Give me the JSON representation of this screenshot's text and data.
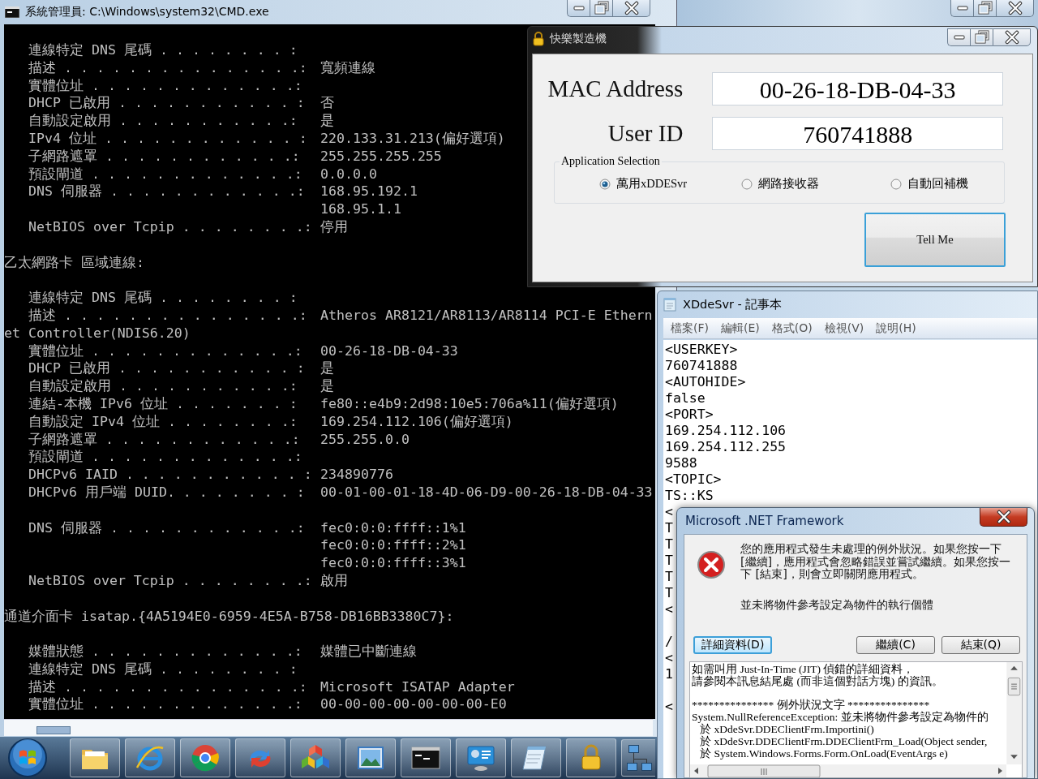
{
  "cmd_window": {
    "title": "系統管理員: C:\\Windows\\system32\\CMD.exe",
    "lines": [
      {
        "kind": "entry",
        "label": "連線特定 DNS 尾碼 . . . . . . . . :"
      },
      {
        "kind": "entry",
        "label": "描述 . . . . . . . . . . . . . . .:",
        "value": "寬頻連線"
      },
      {
        "kind": "entry",
        "label": "實體位址 . . . . . . . . . . . . .:"
      },
      {
        "kind": "entry",
        "label": "DHCP 已啟用 . . . . . . . . . . . :",
        "value": "否"
      },
      {
        "kind": "entry",
        "label": "自動設定啟用 . . . . . . . . . . .:",
        "value": "是"
      },
      {
        "kind": "entry",
        "label": "IPv4 位址 . . . . . . . . . . . . :",
        "value": "220.133.31.213(偏好選項)"
      },
      {
        "kind": "entry",
        "label": "子網路遮罩 . . . . . . . . . . . .:",
        "value": "255.255.255.255"
      },
      {
        "kind": "entry",
        "label": "預設閘道 . . . . . . . . . . . . .:",
        "value": "0.0.0.0"
      },
      {
        "kind": "entry",
        "label": "DNS 伺服器 . . . . . . . . . . . .:",
        "value": "168.95.192.1"
      },
      {
        "kind": "continuation",
        "value": "168.95.1.1"
      },
      {
        "kind": "entry",
        "label": "NetBIOS over Tcpip . . . . . . . .:",
        "value": "停用"
      },
      {
        "kind": "blank"
      },
      {
        "kind": "heading",
        "text": "乙太網路卡 區域連線:"
      },
      {
        "kind": "blank"
      },
      {
        "kind": "entry",
        "label": "連線特定 DNS 尾碼 . . . . . . . . :"
      },
      {
        "kind": "entry",
        "label": "描述 . . . . . . . . . . . . . . .:",
        "value": "Atheros AR8121/AR8113/AR8114 PCI-E Ethern"
      },
      {
        "kind": "heading",
        "text": "et Controller(NDIS6.20)"
      },
      {
        "kind": "entry",
        "label": "實體位址 . . . . . . . . . . . . .:",
        "value": "00-26-18-DB-04-33"
      },
      {
        "kind": "entry",
        "label": "DHCP 已啟用 . . . . . . . . . . . :",
        "value": "是"
      },
      {
        "kind": "entry",
        "label": "自動設定啟用 . . . . . . . . . . .:",
        "value": "是"
      },
      {
        "kind": "entry",
        "label": "連結-本機 IPv6 位址 . . . . . . . :",
        "value": "fe80::e4b9:2d98:10e5:706a%11(偏好選項)"
      },
      {
        "kind": "entry",
        "label": "自動設定 IPv4 位址 . . . . . . . .:",
        "value": "169.254.112.106(偏好選項)"
      },
      {
        "kind": "entry",
        "label": "子網路遮罩 . . . . . . . . . . . .:",
        "value": "255.255.0.0"
      },
      {
        "kind": "entry",
        "label": "預設閘道 . . . . . . . . . . . . .:"
      },
      {
        "kind": "entry",
        "label": "DHCPv6 IAID . . . . . . . . . . . :",
        "value": "234890776"
      },
      {
        "kind": "entry",
        "label": "DHCPv6 用戶端 DUID. . . . . . . . :",
        "value": "00-01-00-01-18-4D-06-D9-00-26-18-DB-04-33"
      },
      {
        "kind": "blank"
      },
      {
        "kind": "entry",
        "label": "DNS 伺服器 . . . . . . . . . . . .:",
        "value": "fec0:0:0:ffff::1%1"
      },
      {
        "kind": "continuation",
        "value": "fec0:0:0:ffff::2%1"
      },
      {
        "kind": "continuation",
        "value": "fec0:0:0:ffff::3%1"
      },
      {
        "kind": "entry",
        "label": "NetBIOS over Tcpip . . . . . . . .:",
        "value": "啟用"
      },
      {
        "kind": "blank"
      },
      {
        "kind": "heading",
        "text": "通道介面卡 isatap.{4A5194E0-6959-4E5A-B758-DB16BB3380C7}:"
      },
      {
        "kind": "blank"
      },
      {
        "kind": "entry",
        "label": "媒體狀態 . . . . . . . . . . . . .:",
        "value": "媒體已中斷連線"
      },
      {
        "kind": "entry",
        "label": "連線特定 DNS 尾碼 . . . . . . . . :"
      },
      {
        "kind": "entry",
        "label": "描述 . . . . . . . . . . . . . . .:",
        "value": "Microsoft ISATAP Adapter"
      },
      {
        "kind": "entry",
        "label": "實體位址 . . . . . . . . . . . . .:",
        "value": "00-00-00-00-00-00-00-E0"
      }
    ]
  },
  "app_window": {
    "title": "快樂製造機",
    "fields": [
      {
        "label": "MAC Address",
        "value": "00-26-18-DB-04-33"
      },
      {
        "label": "User ID",
        "value": "760741888"
      }
    ],
    "group_title": "Application Selection",
    "options": [
      {
        "label": "萬用xDDESvr",
        "selected": true
      },
      {
        "label": "網路接收器",
        "selected": false
      },
      {
        "label": "自動回補機",
        "selected": false
      }
    ],
    "button": "Tell Me"
  },
  "notepad": {
    "title": "XDdeSvr - 記事本",
    "menu": [
      "檔案(F)",
      "編輯(E)",
      "格式(O)",
      "檢視(V)",
      "說明(H)"
    ],
    "lines": [
      {
        "kind": "text",
        "text": "<USERKEY>"
      },
      {
        "kind": "text",
        "text": "760741888"
      },
      {
        "kind": "text",
        "text": "<AUTOHIDE>"
      },
      {
        "kind": "text",
        "text": "false"
      },
      {
        "kind": "text",
        "text": "<PORT>"
      },
      {
        "kind": "text",
        "text": "169.254.112.106"
      },
      {
        "kind": "text",
        "text": "169.254.112.255"
      },
      {
        "kind": "text",
        "text": "9588"
      },
      {
        "kind": "text",
        "text": "<TOPIC>"
      },
      {
        "kind": "text",
        "text": "TS::KS"
      },
      {
        "kind": "text",
        "text": "<"
      },
      {
        "kind": "text",
        "text": "T"
      },
      {
        "kind": "text",
        "text": "T"
      },
      {
        "kind": "text",
        "text": "T"
      },
      {
        "kind": "text",
        "text": "T"
      },
      {
        "kind": "text",
        "text": "T"
      },
      {
        "kind": "text",
        "text": "<"
      },
      {
        "kind": "blank"
      },
      {
        "kind": "text",
        "text": "/"
      },
      {
        "kind": "text",
        "text": "<"
      },
      {
        "kind": "text",
        "text": "1"
      },
      {
        "kind": "blank"
      },
      {
        "kind": "text",
        "text": "<"
      }
    ]
  },
  "dialog": {
    "title": "Microsoft .NET Framework",
    "message": "您的應用程式發生未處理的例外狀況。如果您按一下 [繼續]，應用程式會忽略錯誤並嘗試繼續。如果您按一下 [結束]，則會立即關閉應用程式。",
    "error": "並未將物件參考設定為物件的執行個體",
    "buttons": [
      {
        "label": "詳細資料(D)",
        "focused": true
      },
      {
        "label": "繼續(C)",
        "focused": false
      },
      {
        "label": "結束(Q)",
        "focused": false
      }
    ],
    "details": [
      {
        "kind": "text",
        "text": "如需叫用 Just-In-Time (JIT) 偵錯的詳細資料，"
      },
      {
        "kind": "text",
        "text": "請參閱本訊息結尾處 (而非這個對話方塊) 的資訊。"
      },
      {
        "kind": "blank"
      },
      {
        "kind": "text",
        "text": "*************** 例外狀況文字 ***************"
      },
      {
        "kind": "text",
        "text": "System.NullReferenceException: 並未將物件參考設定為物件的"
      },
      {
        "kind": "text",
        "text": "   於 xDdeSvr.DDEClientFrm.Importini()"
      },
      {
        "kind": "text",
        "text": "   於 xDdeSvr.DDEClientFrm.DDEClientFrm_Load(Object sender,"
      },
      {
        "kind": "text",
        "text": "   於 System.Windows.Forms.Form.OnLoad(EventArgs e)"
      }
    ]
  },
  "taskbar": {
    "items": [
      {
        "kind": "folder"
      },
      {
        "kind": "ie"
      },
      {
        "kind": "chrome"
      },
      {
        "kind": "sync"
      },
      {
        "kind": "cubes"
      },
      {
        "kind": "photo"
      },
      {
        "kind": "terminal"
      },
      {
        "kind": "monitor"
      },
      {
        "kind": "notepad"
      },
      {
        "kind": "lock"
      },
      {
        "kind": "network"
      }
    ]
  }
}
